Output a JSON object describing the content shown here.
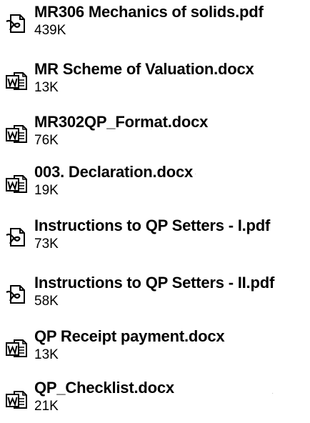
{
  "files": [
    {
      "name": "MR306 Mechanics of solids.pdf",
      "size": "439K",
      "icon": "pdf-file-icon"
    },
    {
      "name": "MR Scheme of Valuation.docx",
      "size": "13K",
      "icon": "word-document-icon"
    },
    {
      "name": "MR302QP_Format.docx",
      "size": "76K",
      "icon": "word-document-icon"
    },
    {
      "name": "003. Declaration.docx",
      "size": "19K",
      "icon": "word-document-icon"
    },
    {
      "name": "Instructions to QP Setters - I.pdf",
      "size": "73K",
      "icon": "pdf-file-icon"
    },
    {
      "name": "Instructions to QP Setters - II.pdf",
      "size": "58K",
      "icon": "pdf-file-icon"
    },
    {
      "name": "QP Receipt payment.docx",
      "size": "13K",
      "icon": "word-document-icon"
    },
    {
      "name": "QP_Checklist.docx",
      "size": "21K",
      "icon": "word-document-icon"
    }
  ]
}
